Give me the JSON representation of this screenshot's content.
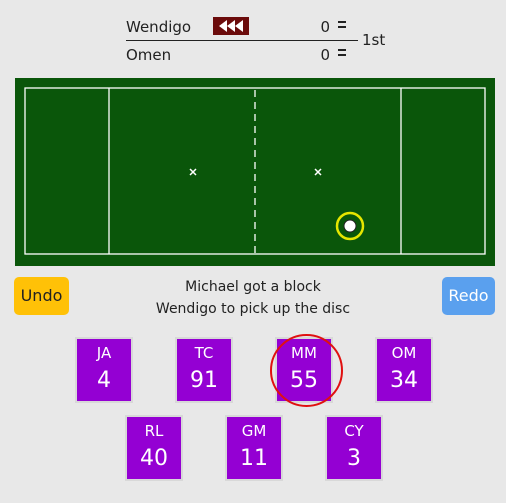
{
  "scoreboard": {
    "teams": [
      {
        "name": "Wendigo",
        "score": "0"
      },
      {
        "name": "Omen",
        "score": "0"
      }
    ],
    "period": "1st"
  },
  "status": {
    "line1": "Michael got a block",
    "line2": "Wendigo to pick up the disc"
  },
  "buttons": {
    "undo": "Undo",
    "redo": "Redo"
  },
  "players": [
    {
      "initials": "JA",
      "number": "4"
    },
    {
      "initials": "TC",
      "number": "91"
    },
    {
      "initials": "MM",
      "number": "55"
    },
    {
      "initials": "OM",
      "number": "34"
    },
    {
      "initials": "RL",
      "number": "40"
    },
    {
      "initials": "GM",
      "number": "11"
    },
    {
      "initials": "CY",
      "number": "3"
    }
  ],
  "colors": {
    "field": "#0a560a",
    "player_tile": "#9400d3",
    "undo": "#ffc107",
    "redo": "#5aa0ee",
    "possession": "#6b0b0b",
    "disc_ring": "#e6e600",
    "highlight": "#e01010"
  },
  "icons": {
    "possession": "rewind-icon",
    "menu": "menu-icon",
    "disc": "disc-icon",
    "brick_mark": "x-mark-icon"
  }
}
